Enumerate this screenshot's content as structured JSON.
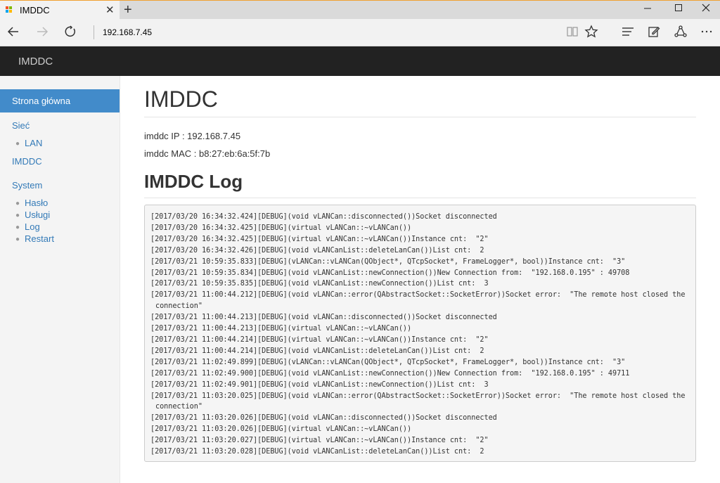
{
  "browser": {
    "tab_title": "IMDDC",
    "new_tab": "+",
    "close": "✕",
    "url": "192.168.7.45",
    "favicon_colors": [
      "#f25022",
      "#7fba00",
      "#00a4ef",
      "#ffb900"
    ]
  },
  "header": {
    "brand": "IMDDC"
  },
  "sidebar": {
    "active": "Strona główna",
    "siec": "Sieć",
    "lan": "LAN",
    "imddc": "IMDDC",
    "system": "System",
    "haslo": "Hasło",
    "uslugi": "Usługi",
    "log": "Log",
    "restart": "Restart"
  },
  "main": {
    "title": "IMDDC",
    "ip_line": "imddc IP : 192.168.7.45",
    "mac_line": "imddc MAC : b8:27:eb:6a:5f:7b",
    "log_title": "IMDDC Log",
    "log": [
      "[2017/03/20 16:34:32.424][DEBUG](void vLANCan::disconnected())Socket disconnected",
      "[2017/03/20 16:34:32.425][DEBUG](virtual vLANCan::~vLANCan())",
      "[2017/03/20 16:34:32.425][DEBUG](virtual vLANCan::~vLANCan())Instance cnt:  \"2\"",
      "[2017/03/20 16:34:32.426][DEBUG](void vLANCanList::deleteLanCan())List cnt:  2",
      "[2017/03/21 10:59:35.833][DEBUG](vLANCan::vLANCan(QObject*, QTcpSocket*, FrameLogger*, bool))Instance cnt:  \"3\"",
      "[2017/03/21 10:59:35.834][DEBUG](void vLANCanList::newConnection())New Connection from:  \"192.168.0.195\" : 49708",
      "[2017/03/21 10:59:35.835][DEBUG](void vLANCanList::newConnection())List cnt:  3",
      "[2017/03/21 11:00:44.212][DEBUG](void vLANCan::error(QAbstractSocket::SocketError))Socket error:  \"The remote host closed the connection\"",
      "[2017/03/21 11:00:44.213][DEBUG](void vLANCan::disconnected())Socket disconnected",
      "[2017/03/21 11:00:44.213][DEBUG](virtual vLANCan::~vLANCan())",
      "[2017/03/21 11:00:44.214][DEBUG](virtual vLANCan::~vLANCan())Instance cnt:  \"2\"",
      "[2017/03/21 11:00:44.214][DEBUG](void vLANCanList::deleteLanCan())List cnt:  2",
      "[2017/03/21 11:02:49.899][DEBUG](vLANCan::vLANCan(QObject*, QTcpSocket*, FrameLogger*, bool))Instance cnt:  \"3\"",
      "[2017/03/21 11:02:49.900][DEBUG](void vLANCanList::newConnection())New Connection from:  \"192.168.0.195\" : 49711",
      "[2017/03/21 11:02:49.901][DEBUG](void vLANCanList::newConnection())List cnt:  3",
      "[2017/03/21 11:03:20.025][DEBUG](void vLANCan::error(QAbstractSocket::SocketError))Socket error:  \"The remote host closed the connection\"",
      "[2017/03/21 11:03:20.026][DEBUG](void vLANCan::disconnected())Socket disconnected",
      "[2017/03/21 11:03:20.026][DEBUG](virtual vLANCan::~vLANCan())",
      "[2017/03/21 11:03:20.027][DEBUG](virtual vLANCan::~vLANCan())Instance cnt:  \"2\"",
      "[2017/03/21 11:03:20.028][DEBUG](void vLANCanList::deleteLanCan())List cnt:  2"
    ]
  }
}
